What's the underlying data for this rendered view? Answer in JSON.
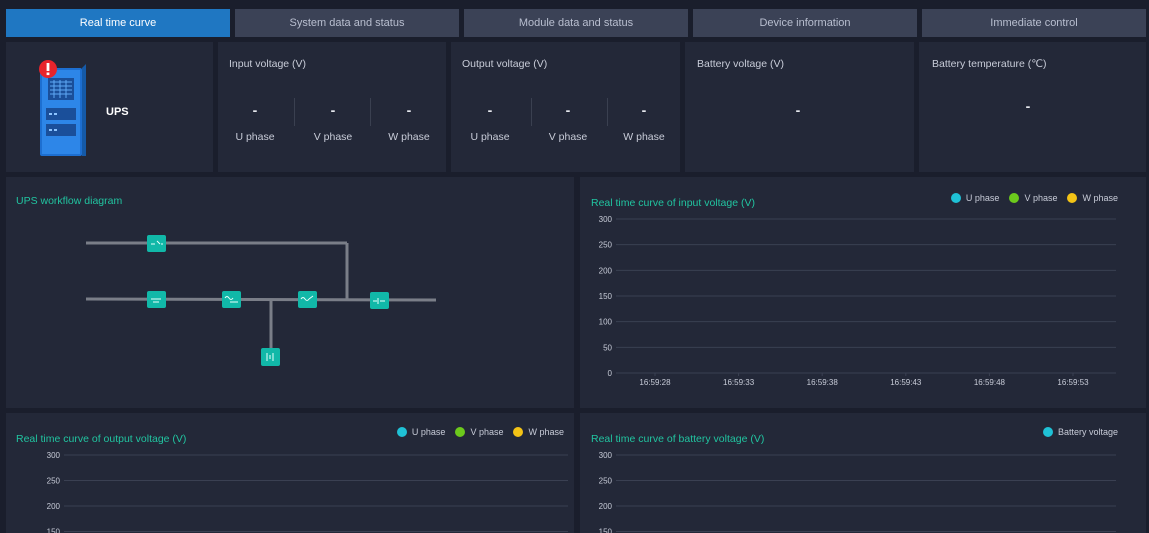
{
  "tabs": [
    {
      "label": "Real time curve",
      "active": true
    },
    {
      "label": "System data and status",
      "active": false
    },
    {
      "label": "Module data and status",
      "active": false
    },
    {
      "label": "Device information",
      "active": false
    },
    {
      "label": "Immediate control",
      "active": false
    }
  ],
  "device": {
    "name": "UPS",
    "alarm_icon": "alarm-icon",
    "device_icon": "ups-cabinet-icon"
  },
  "input_voltage": {
    "title": "Input voltage (V)",
    "phases": [
      {
        "label": "U phase",
        "value": "-"
      },
      {
        "label": "V phase",
        "value": "-"
      },
      {
        "label": "W phase",
        "value": "-"
      }
    ]
  },
  "output_voltage": {
    "title": "Output voltage (V)",
    "phases": [
      {
        "label": "U phase",
        "value": "-"
      },
      {
        "label": "V phase",
        "value": "-"
      },
      {
        "label": "W phase",
        "value": "-"
      }
    ]
  },
  "battery_voltage": {
    "title": "Battery voltage (V)",
    "value": "-"
  },
  "battery_temperature": {
    "title": "Battery temperature (℃)",
    "value": "-"
  },
  "workflow": {
    "title": "UPS workflow diagram"
  },
  "colors": {
    "u_phase": "#1fc1d6",
    "v_phase": "#6cc91c",
    "w_phase": "#f3c316",
    "accent": "#21c4a0",
    "tab_active": "#1f77c2"
  },
  "chart_data": [
    {
      "type": "line",
      "title": "Real time curve of input voltage (V)",
      "x": [
        "16:59:28",
        "16:59:33",
        "16:59:38",
        "16:59:43",
        "16:59:48",
        "16:59:53"
      ],
      "ylim": [
        0,
        300
      ],
      "yticks": [
        0,
        50,
        100,
        150,
        200,
        250,
        300
      ],
      "series": [
        {
          "name": "U phase",
          "values": []
        },
        {
          "name": "V phase",
          "values": []
        },
        {
          "name": "W phase",
          "values": []
        }
      ],
      "legend": "top-right"
    },
    {
      "type": "line",
      "title": "Real time curve of output voltage (V)",
      "yticks": [
        150,
        200,
        250,
        300
      ],
      "series": [
        {
          "name": "U phase",
          "values": []
        },
        {
          "name": "V phase",
          "values": []
        },
        {
          "name": "W phase",
          "values": []
        }
      ],
      "legend": "top-right"
    },
    {
      "type": "line",
      "title": "Real time curve of battery voltage (V)",
      "yticks": [
        150,
        200,
        250,
        300
      ],
      "series": [
        {
          "name": "Battery voltage",
          "values": []
        }
      ],
      "legend": "top-right"
    }
  ]
}
